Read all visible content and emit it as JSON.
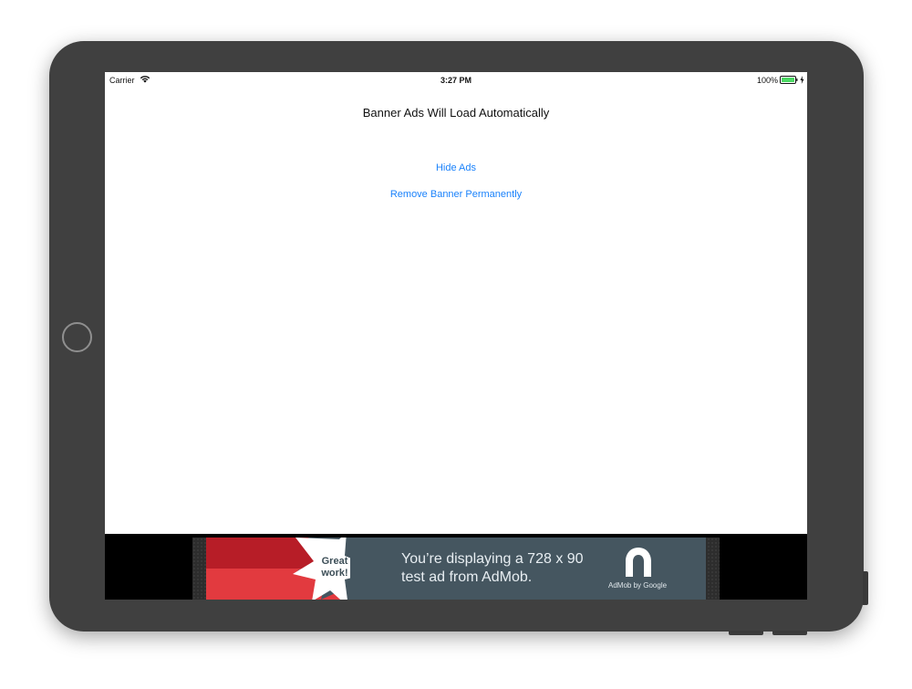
{
  "status_bar": {
    "carrier": "Carrier",
    "time": "3:27 PM",
    "battery": "100%",
    "wifi_icon": "wifi-icon",
    "battery_icon": "battery-icon",
    "battery_color": "#4cd964"
  },
  "main": {
    "title": "Banner Ads Will Load Automatically",
    "hide_ads_label": "Hide Ads",
    "remove_banner_label": "Remove Banner Permanently",
    "link_color": "#1a82fb"
  },
  "ad": {
    "badge_text": "Great\nwork!",
    "message": "You’re displaying a 728 x 90\ntest ad from AdMob.",
    "byline": "AdMob by Google",
    "logo_icon": "admob-logo-icon",
    "colors": {
      "background": "#455660",
      "red_dark": "#b71d27",
      "red_light": "#e23a3f"
    }
  }
}
